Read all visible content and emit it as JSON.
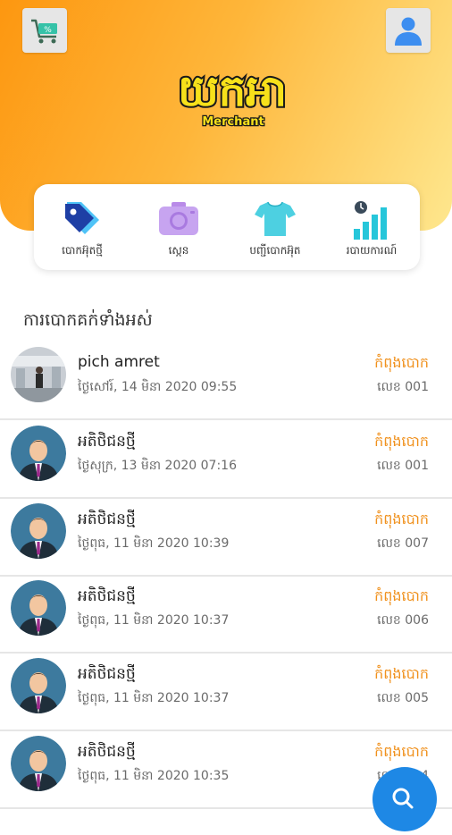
{
  "header": {
    "logo_text": "យកអា",
    "logo_sub": "Merchant",
    "brand_color": "#fd9710"
  },
  "menu": [
    {
      "label": "បោកអ៊ុតថ្មី",
      "icon": "tag-icon"
    },
    {
      "label": "ស្កេន",
      "icon": "camera-icon"
    },
    {
      "label": "បញ្ជីបោកអ៊ុត",
      "icon": "shirt-icon"
    },
    {
      "label": "របាយការណ៍",
      "icon": "chart-icon"
    }
  ],
  "section_title": "ការបោកគក់ទាំងអស់",
  "orders": [
    {
      "name": "pich amret",
      "date": "ថ្ងៃសៅរ៍, 14 មិនា 2020 09:55",
      "status": "កំពុងបោក",
      "number": "លេខ 001",
      "avatar": "photo"
    },
    {
      "name": "អតិថិជនថ្មី",
      "date": "ថ្ងៃសុក្រ, 13 មិនា 2020 07:16",
      "status": "កំពុងបោក",
      "number": "លេខ 001",
      "avatar": "default"
    },
    {
      "name": "អតិថិជនថ្មី",
      "date": "ថ្ងៃពុធ, 11 មិនា 2020 10:39",
      "status": "កំពុងបោក",
      "number": "លេខ 007",
      "avatar": "default"
    },
    {
      "name": "អតិថិជនថ្មី",
      "date": "ថ្ងៃពុធ, 11 មិនា 2020 10:37",
      "status": "កំពុងបោក",
      "number": "លេខ 006",
      "avatar": "default"
    },
    {
      "name": "អតិថិជនថ្មី",
      "date": "ថ្ងៃពុធ, 11 មិនា 2020 10:37",
      "status": "កំពុងបោក",
      "number": "លេខ 005",
      "avatar": "default"
    },
    {
      "name": "អតិថិជនថ្មី",
      "date": "ថ្ងៃពុធ, 11 មិនា 2020 10:35",
      "status": "កំពុងបោក",
      "number": "លេខ 004",
      "avatar": "default"
    }
  ],
  "colors": {
    "status": "#f0911d",
    "fab": "#1e88e5"
  }
}
